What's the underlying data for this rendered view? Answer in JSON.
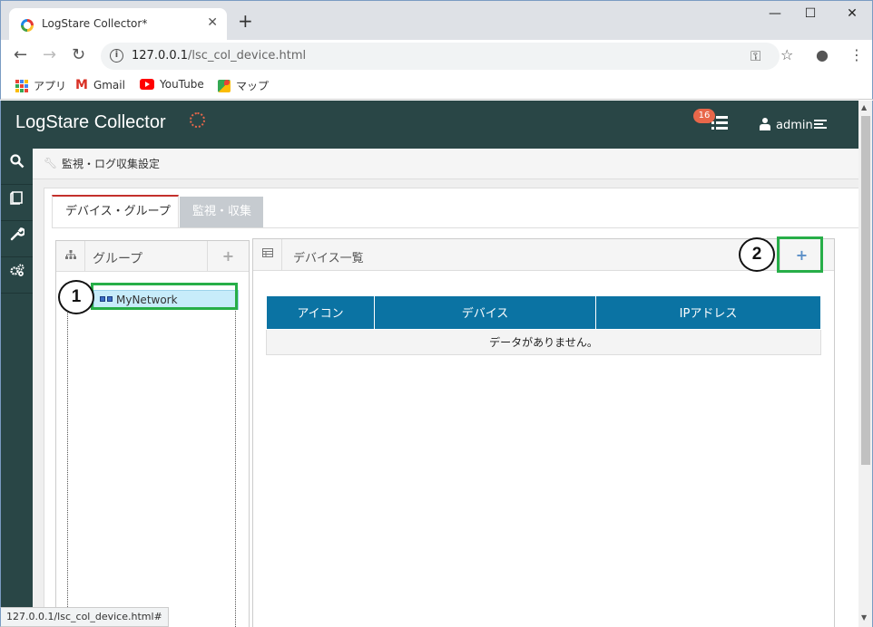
{
  "browser": {
    "tab_title": "LogStare Collector*",
    "url_host": "127.0.0.1",
    "url_path": "/lsc_col_device.html",
    "bookmarks": [
      "アプリ",
      "Gmail",
      "YouTube",
      "マップ"
    ],
    "status_url": "127.0.0.1/lsc_col_device.html#"
  },
  "app": {
    "title": "LogStare Collector",
    "notification_count": "16",
    "user_name": "admin"
  },
  "sidebar": {
    "items": [
      {
        "icon": "search-icon"
      },
      {
        "icon": "book-icon"
      },
      {
        "icon": "wrench-icon"
      },
      {
        "icon": "gears-icon"
      }
    ]
  },
  "breadcrumb": {
    "text": "監視・ログ収集設定"
  },
  "tabs": [
    {
      "label": "デバイス・グループ",
      "active": true
    },
    {
      "label": "監視・収集",
      "active": false
    }
  ],
  "group_panel": {
    "title": "グループ",
    "add_label": "+",
    "tree": [
      {
        "label": "MyNetwork",
        "selected": true
      }
    ]
  },
  "device_panel": {
    "title": "デバイス一覧",
    "add_label": "+",
    "columns": [
      "アイコン",
      "デバイス",
      "IPアドレス"
    ],
    "empty_message": "データがありません。"
  },
  "annotations": {
    "callout_1": "1",
    "callout_2": "2",
    "highlight_color": "#27ae48"
  },
  "colors": {
    "header_bg": "#294646",
    "table_header_bg": "#0b73a3",
    "badge_bg": "#e8674a",
    "active_tab_border": "#c4302b"
  }
}
